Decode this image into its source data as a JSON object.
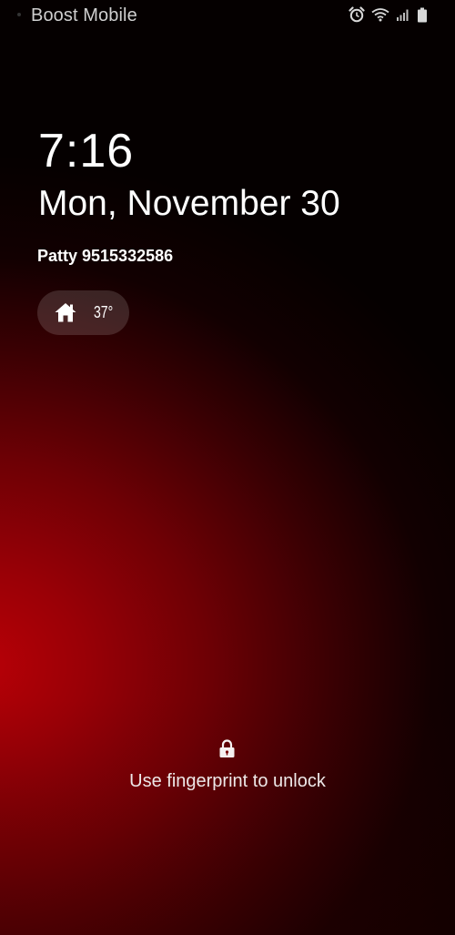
{
  "status_bar": {
    "carrier": "Boost Mobile",
    "icons": [
      "alarm-icon",
      "wifi-icon",
      "signal-icon",
      "battery-icon"
    ]
  },
  "lockscreen": {
    "time": "7:16",
    "date": "Mon, November 30",
    "owner_info": "Patty 9515332586",
    "weather": {
      "icon": "home-icon",
      "temperature": "37°"
    },
    "unlock_icon": "lock-icon",
    "unlock_hint": "Use fingerprint to unlock"
  },
  "colors": {
    "wallpaper_red": "#b80007",
    "wallpaper_dark": "#050000",
    "text": "#ffffff",
    "carrier_text": "#cfcfcf"
  }
}
